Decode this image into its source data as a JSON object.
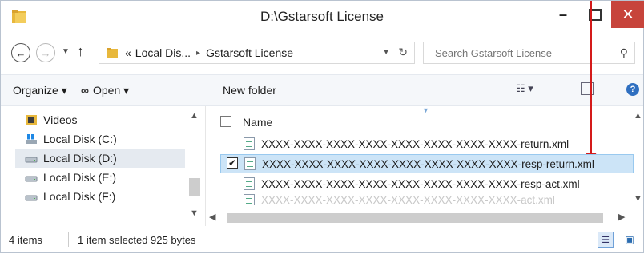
{
  "window": {
    "title": "D:\\Gstarsoft License",
    "minimize": "–",
    "close": "✕"
  },
  "address": {
    "back": "←",
    "forward": "→",
    "up": "↑",
    "path_prefix": "«",
    "segments": [
      "Local Dis...",
      "Gstarsoft License"
    ],
    "separator": "▸",
    "search_placeholder": "Search Gstarsoft License"
  },
  "toolbar": {
    "organize": "Organize ▾",
    "open": "Open ▾",
    "new_folder": "New folder",
    "views": "☷ ▾",
    "help": "?"
  },
  "nav": {
    "items": [
      {
        "label": "Videos",
        "icon": "videos-folder-icon"
      },
      {
        "label": "Local Disk (C:)",
        "icon": "windows-drive-icon"
      },
      {
        "label": "Local Disk (D:)",
        "icon": "drive-icon",
        "selected": true
      },
      {
        "label": "Local Disk (E:)",
        "icon": "drive-icon"
      },
      {
        "label": "Local Disk (F:)",
        "icon": "drive-icon"
      }
    ]
  },
  "files": {
    "header_name": "Name",
    "rows": [
      {
        "name": "XXXX-XXXX-XXXX-XXXX-XXXX-XXXX-XXXX-XXXX-return.xml",
        "selected": false
      },
      {
        "name": "XXXX-XXXX-XXXX-XXXX-XXXX-XXXX-XXXX-XXXX-resp-return.xml",
        "selected": true
      },
      {
        "name": "XXXX-XXXX-XXXX-XXXX-XXXX-XXXX-XXXX-XXXX-resp-act.xml",
        "selected": false
      },
      {
        "name": "XXXX-XXXX-XXXX-XXXX-XXXX-XXXX-XXXX-XXXX-act.xml",
        "selected": false
      }
    ]
  },
  "status": {
    "items": "4 items",
    "selection": "1 item selected  925 bytes"
  },
  "colors": {
    "close_red": "#c7443b",
    "annotation_arrow": "#d41a1a",
    "selection_bg": "#cce4f7",
    "folder_yellow": "#e8b83c"
  }
}
